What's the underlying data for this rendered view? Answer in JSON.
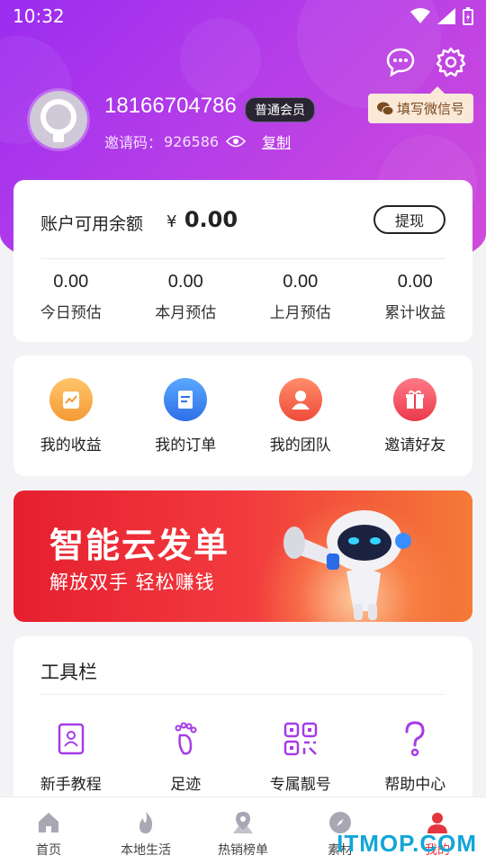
{
  "status_bar": {
    "time": "10:32"
  },
  "profile": {
    "phone": "18166704786",
    "member_level": "普通会员",
    "invite_label": "邀请码：",
    "invite_code": "926586",
    "copy_label": "复制",
    "wechat_tag": "填写微信号"
  },
  "balance": {
    "label": "账户可用余额",
    "currency": "¥",
    "value": "0.00",
    "withdraw_label": "提现",
    "stats": [
      {
        "value": "0.00",
        "label": "今日预估"
      },
      {
        "value": "0.00",
        "label": "本月预估"
      },
      {
        "value": "0.00",
        "label": "上月预估"
      },
      {
        "value": "0.00",
        "label": "累计收益"
      }
    ]
  },
  "menu": [
    {
      "label": "我的收益",
      "icon": "earnings-icon",
      "color": "#f7a94a"
    },
    {
      "label": "我的订单",
      "icon": "orders-icon",
      "color": "#3d8ef5"
    },
    {
      "label": "我的团队",
      "icon": "team-icon",
      "color": "#f36b4f"
    },
    {
      "label": "邀请好友",
      "icon": "gift-icon",
      "color": "#f2525e"
    }
  ],
  "banner": {
    "title": "智能云发单",
    "subtitle": "解放双手 轻松赚钱"
  },
  "tools": {
    "title": "工具栏",
    "items": [
      {
        "label": "新手教程",
        "icon": "tutorial-icon"
      },
      {
        "label": "足迹",
        "icon": "footprint-icon"
      },
      {
        "label": "专属靓号",
        "icon": "qrcode-icon"
      },
      {
        "label": "帮助中心",
        "icon": "help-icon"
      }
    ]
  },
  "tabbar": [
    {
      "label": "首页",
      "icon": "home-icon"
    },
    {
      "label": "本地生活",
      "icon": "flame-icon"
    },
    {
      "label": "热销榜单",
      "icon": "map-pin-icon"
    },
    {
      "label": "素材",
      "icon": "compass-icon"
    },
    {
      "label": "我的",
      "icon": "user-icon",
      "active": true
    }
  ],
  "watermark": "ITMOP.COM",
  "colors": {
    "hero_start": "#9b2cf0",
    "hero_end": "#d24cd8",
    "accent_red": "#e5363f",
    "tool_purple": "#a63be6"
  }
}
